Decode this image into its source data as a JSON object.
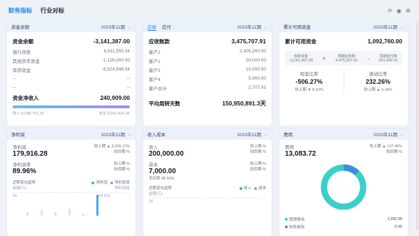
{
  "tabs": [
    {
      "label": "财务指标"
    },
    {
      "label": "行业对标"
    }
  ],
  "cash": {
    "title": "资金余额",
    "period": "2023年11期",
    "main_label": "资金余额",
    "main_value": "-3,141,387.00",
    "rows": [
      {
        "label": "银行存款",
        "value": "6,511,555.54"
      },
      {
        "label": "其他货币资金",
        "value": "-1,126,000.00"
      },
      {
        "label": "库存现金",
        "value": "-8,524,946.54"
      },
      {
        "label": "--",
        "value": "--"
      },
      {
        "label": "--",
        "value": "--"
      }
    ],
    "net_label": "资金净收入",
    "net_value": "240,909.00",
    "in_label": "收入",
    "in_value": "9,088,753.36",
    "out_label": "支出",
    "out_value": "8,847,834.36"
  },
  "receivable": {
    "tab1": "应收",
    "tab2": "应付",
    "period": "2023年11期",
    "main_label": "应收账款",
    "main_value": "3,475,707.91",
    "rows": [
      {
        "label": "客户2",
        "value": "3,305,200.00"
      },
      {
        "label": "客户1",
        "value": "50,000.00"
      },
      {
        "label": "客户3",
        "value": "10,000.00"
      },
      {
        "label": "客户4",
        "value": "5,000.00"
      },
      {
        "label": "客户合计",
        "value": "2,707.91"
      }
    ],
    "avg_label": "平均周转天数",
    "avg_value": "150,950,891.3天"
  },
  "available": {
    "title": "累计可用资金",
    "period": "2023年11期",
    "main_label": "累计可用资金",
    "main_value": "1,092,760.00",
    "items": [
      {
        "label": "现有资金",
        "value": "-3,141,387.00"
      },
      {
        "label": "短期应收款",
        "value": "4,475,207.91"
      },
      {
        "label": "短期应付款",
        "value": "241,060.91"
      }
    ],
    "op_plus": "+",
    "op_minus": "-",
    "ratio1_label": "现金比率",
    "ratio1_value": "-506.27%",
    "ratio1_delta": "较上期 ▼ 8.16%",
    "ratio2_label": "速动比率",
    "ratio2_value": "232.26%",
    "ratio2_delta": "较上期 ▲ 0.16%"
  },
  "profit": {
    "title": "净利润",
    "period": "2023年11期",
    "net_label": "净利润",
    "net_value": "179,916.28",
    "net_delta1": "较上期 ▲ 3,325.27%",
    "net_delta2": "较同期 %",
    "margin_label": "净利润率",
    "margin_value": "89.96%",
    "margin_delta1": "较上期 %",
    "margin_delta2": "较同期 %",
    "trend_label": "近期变化趋势",
    "legend1": "净利润",
    "legend2": "净利润率",
    "axis_l": "金额(万)",
    "axis_r": "净利润率",
    "tick1": "20",
    "tick2": "78,615",
    "columns": [
      0.15,
      0.25,
      0.2,
      0.3,
      0.1,
      0.95
    ]
  },
  "income": {
    "title": "收入成本",
    "period": "2023年11期",
    "rev_label": "收入",
    "rev_value": "200,000.00",
    "rev_delta1": "较上期 %",
    "rev_delta2": "较同期 %",
    "cost_label": "成本",
    "cost_value": "7,000.00",
    "cost_delta1": "较上期 %",
    "cost_delta2": "较同期 %",
    "gross_label": "毛利率",
    "gross_value": "96.50%",
    "trend_label": "近期变化趋势",
    "legend1": "收入",
    "legend2": "成本",
    "axis_l": "金额(万)",
    "tick1": "20"
  },
  "expense": {
    "title": "费用",
    "period": "2023年11期",
    "main_label": "费用",
    "main_value": "13,083.72",
    "delta1": "较上期 ▲ 137.45%",
    "delta2": "较同期 %",
    "legend": [
      {
        "label": "管理费用",
        "value": "1,932.00"
      },
      {
        "label": "财务费用",
        "value": "0.00"
      }
    ],
    "share": 0.12,
    "colors": {
      "main": "#3ad0c8",
      "accent": "#3d8fe0"
    }
  }
}
